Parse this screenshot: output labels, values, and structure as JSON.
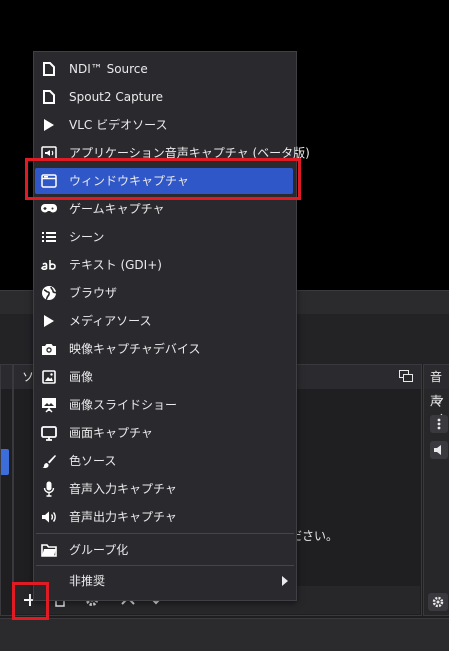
{
  "docks": {
    "sources_title": "ソ",
    "audio_title": "音声",
    "audio_sub": "マイ",
    "hint_text": "ださい。"
  },
  "menu": {
    "items": [
      {
        "label": "NDI™ Source",
        "icon": "file-icon"
      },
      {
        "label": "Spout2 Capture",
        "icon": "file-icon"
      },
      {
        "label": "VLC ビデオソース",
        "icon": "play-icon"
      },
      {
        "label": "アプリケーション音声キャプチャ (ベータ版)",
        "icon": "app-audio-icon"
      },
      {
        "label": "ウィンドウキャプチャ",
        "icon": "window-icon"
      },
      {
        "label": "ゲームキャプチャ",
        "icon": "gamepad-icon"
      },
      {
        "label": "シーン",
        "icon": "list-icon"
      },
      {
        "label": "テキスト (GDI+)",
        "icon": "text-ab-icon"
      },
      {
        "label": "ブラウザ",
        "icon": "globe-icon"
      },
      {
        "label": "メディアソース",
        "icon": "play-icon"
      },
      {
        "label": "映像キャプチャデバイス",
        "icon": "camera-icon"
      },
      {
        "label": "画像",
        "icon": "image-icon"
      },
      {
        "label": "画像スライドショー",
        "icon": "slideshow-icon"
      },
      {
        "label": "画面キャプチャ",
        "icon": "monitor-icon"
      },
      {
        "label": "色ソース",
        "icon": "brush-icon"
      },
      {
        "label": "音声入力キャプチャ",
        "icon": "microphone-icon"
      },
      {
        "label": "音声出力キャプチャ",
        "icon": "speaker-icon"
      },
      {
        "label": "グループ化",
        "icon": "folder-icon"
      },
      {
        "label": "非推奨",
        "icon": ""
      }
    ],
    "active_index": 4
  },
  "colors": {
    "accent": "#2f57c7",
    "highlight_box": "#e01b24"
  }
}
